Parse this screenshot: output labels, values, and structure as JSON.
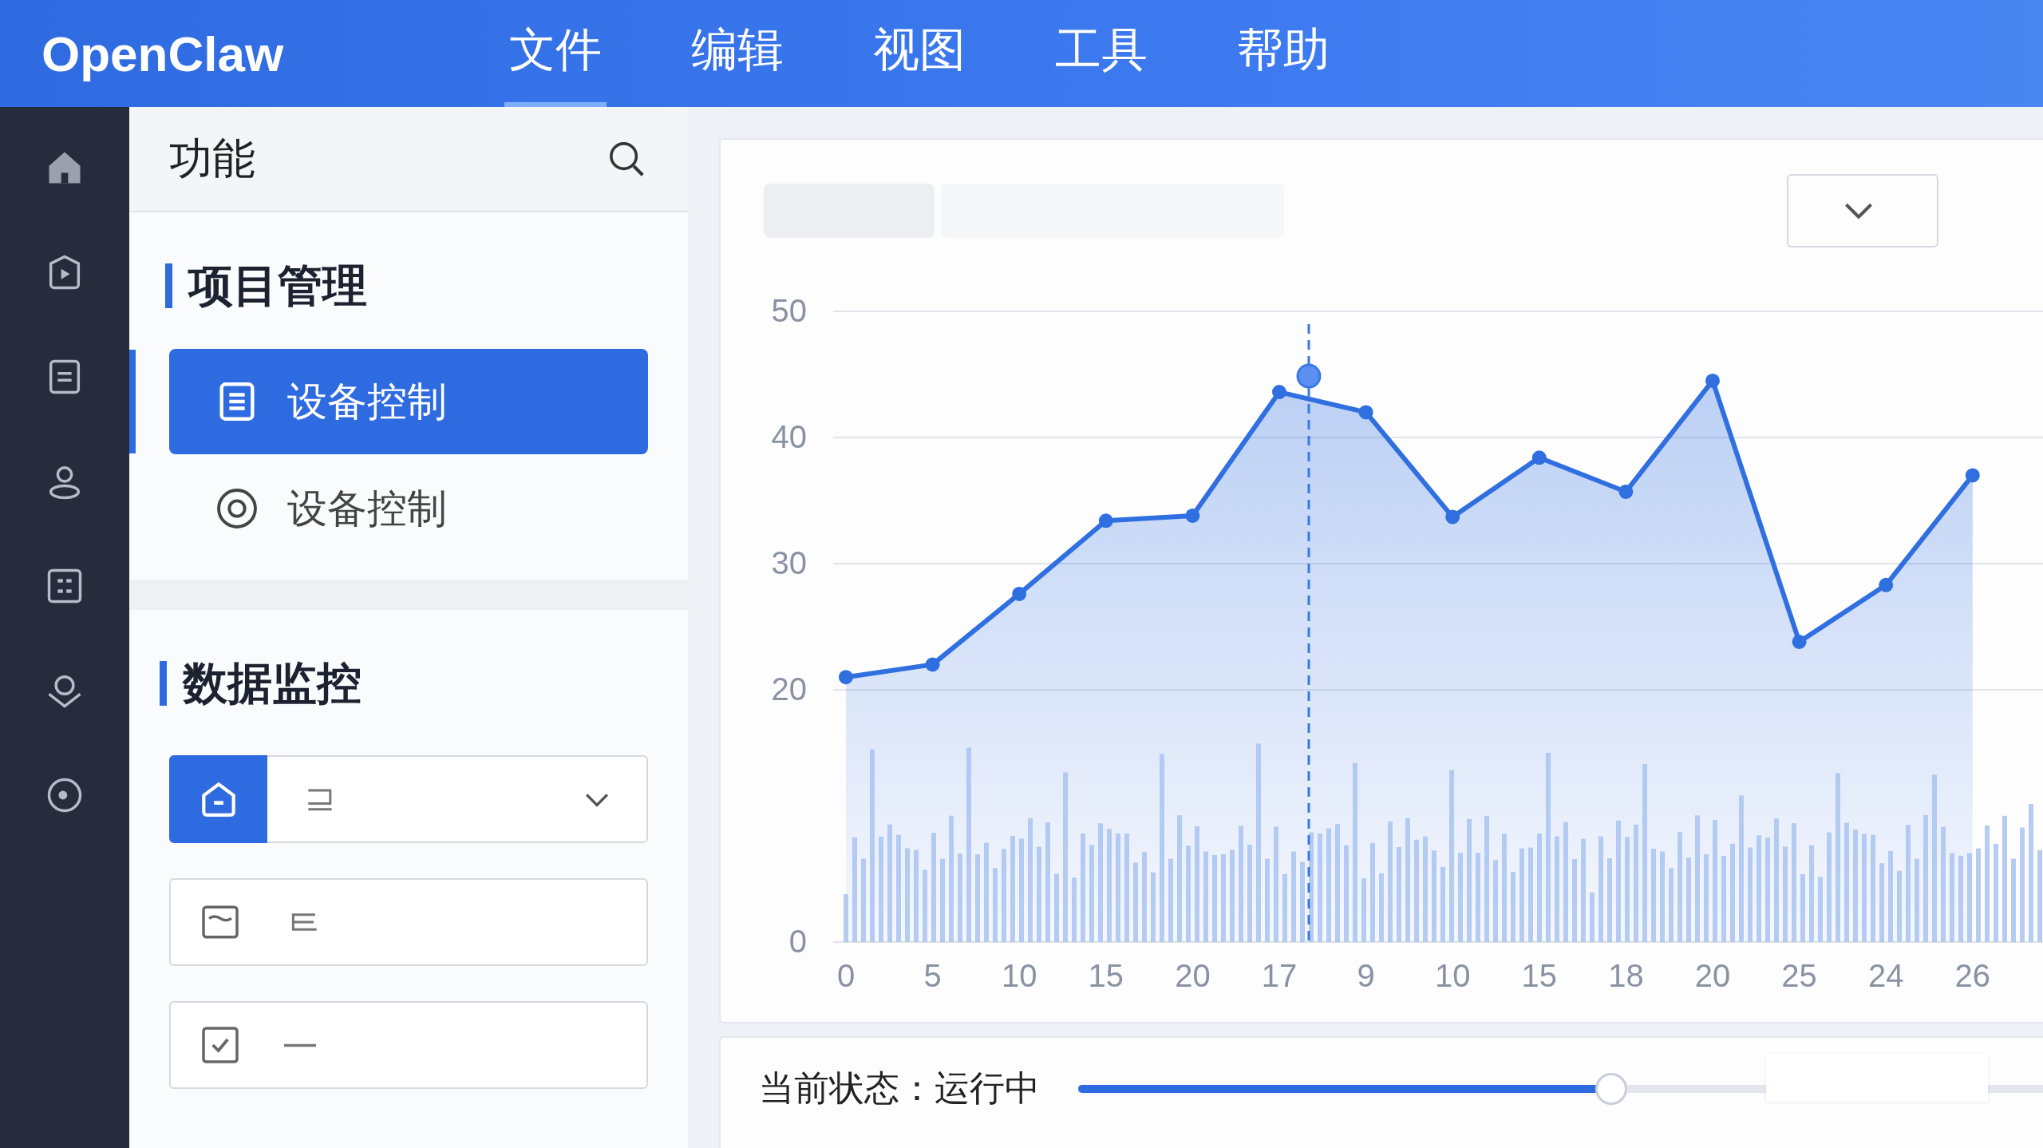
{
  "app": {
    "title": "OpenClaw"
  },
  "menu": [
    {
      "label": "文件",
      "selected": true
    },
    {
      "label": "编辑",
      "selected": false
    },
    {
      "label": "视图",
      "selected": false
    },
    {
      "label": "工具",
      "selected": false
    },
    {
      "label": "帮助",
      "selected": false
    }
  ],
  "panel": {
    "title": "功能",
    "project": {
      "title": "项目管理",
      "items": [
        {
          "label": "设备控制",
          "selected": true,
          "kind": "document"
        },
        {
          "label": "设备控制",
          "selected": false,
          "kind": "target"
        }
      ]
    },
    "monitor": {
      "title": "数据监控",
      "rows": [
        {
          "kind": "dropdown"
        },
        {
          "kind": "field"
        },
        {
          "kind": "checkbox",
          "checked": true
        }
      ]
    }
  },
  "chart": {
    "chart_data": {
      "type": "area",
      "categories": [
        "0",
        "5",
        "10",
        "15",
        "20",
        "17",
        "9",
        "10",
        "15",
        "18",
        "20",
        "25",
        "24",
        "26"
      ],
      "series": [
        {
          "color": "#2f6fe0",
          "values": [
            21,
            22,
            27.6,
            33.4,
            33.8,
            43.6,
            42,
            33.7,
            38.4,
            35.7,
            44.5,
            23.8,
            28.3,
            37
          ]
        }
      ],
      "yticks": [
        0,
        20,
        30,
        40,
        50
      ],
      "ylim": [
        0,
        50
      ],
      "grid": true
    }
  },
  "status": {
    "label": "当前状态：运行中",
    "level": 0.55
  }
}
